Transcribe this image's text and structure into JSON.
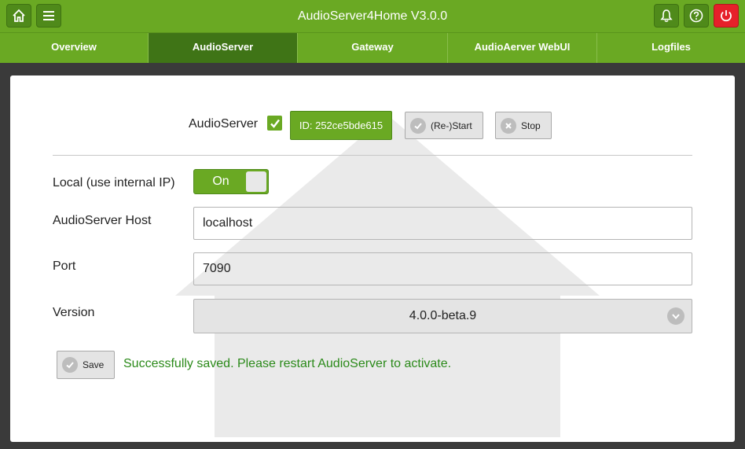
{
  "header": {
    "title": "AudioServer4Home V3.0.0",
    "icons": [
      "home-icon",
      "menu-icon",
      "bell-icon",
      "help-icon",
      "power-icon"
    ]
  },
  "tabs": [
    {
      "label": "Overview",
      "active": false
    },
    {
      "label": "AudioServer",
      "active": true
    },
    {
      "label": "Gateway",
      "active": false
    },
    {
      "label": "AudioAerver WebUI",
      "active": false
    },
    {
      "label": "Logfiles",
      "active": false
    }
  ],
  "audioserver": {
    "label": "AudioServer",
    "enabled": true,
    "id_label": "ID: 252ce5bde615",
    "restart_label": "(Re-)Start",
    "stop_label": "Stop"
  },
  "form": {
    "local_label": "Local (use internal IP)",
    "local_toggle": "On",
    "host_label": "AudioServer Host",
    "host_value": "localhost",
    "port_label": "Port",
    "port_value": "7090",
    "version_label": "Version",
    "version_value": "4.0.0-beta.9"
  },
  "save_label": "Save",
  "message": "Successfully saved. Please restart AudioServer to activate.",
  "colors": {
    "accent": "#6aa923",
    "accent_dark": "#3f7416",
    "danger": "#e6202a",
    "success_text": "#2b8a1a"
  }
}
